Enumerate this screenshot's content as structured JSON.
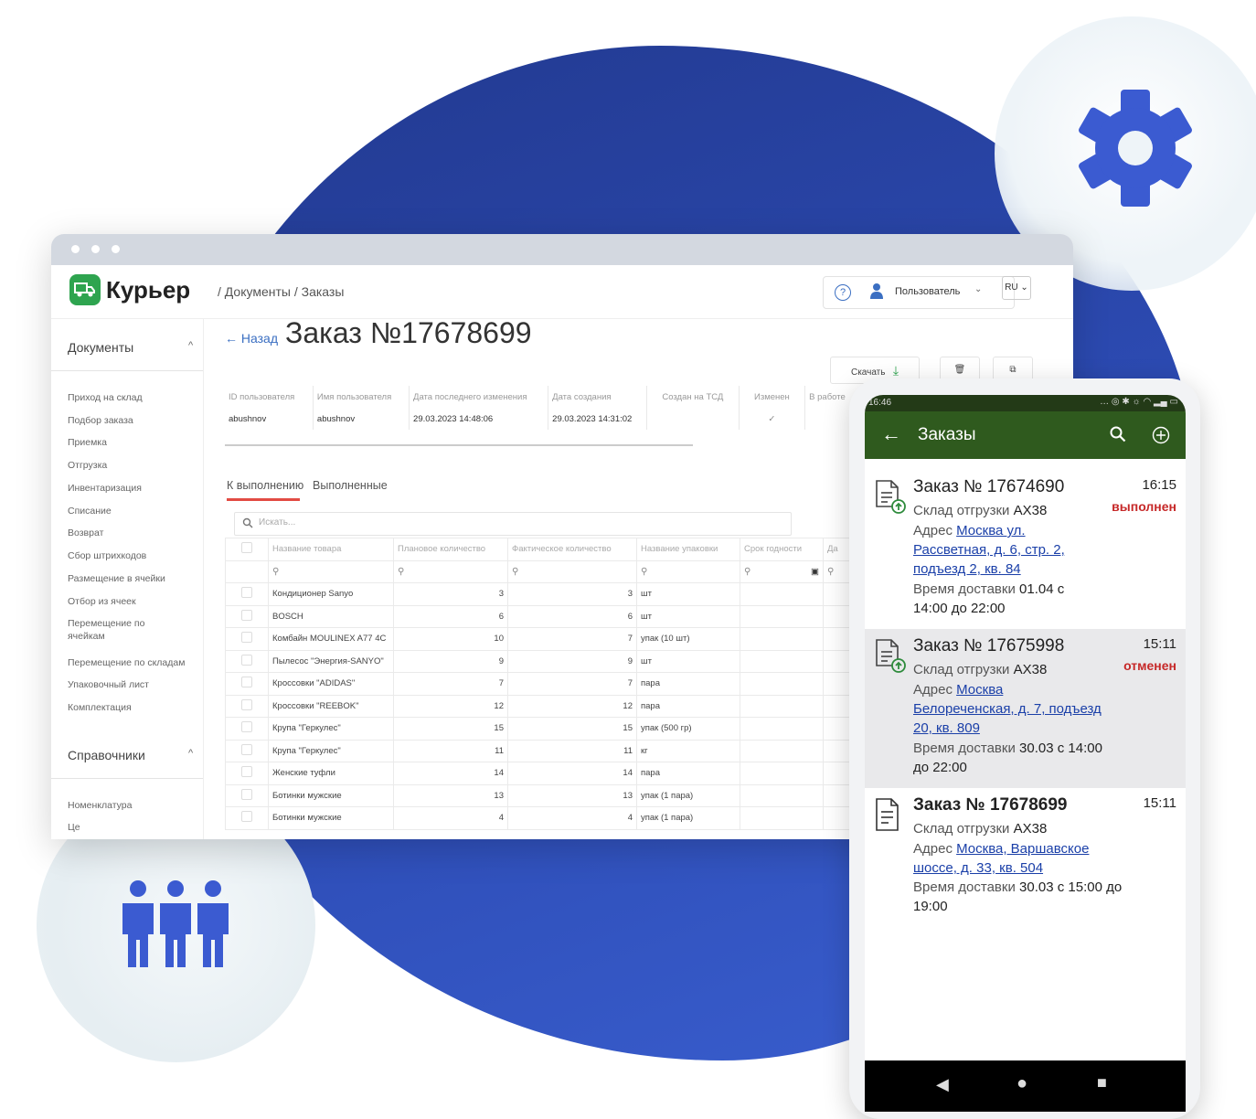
{
  "desktop": {
    "logo": "Курьер",
    "breadcrumb": "/ Документы / Заказы",
    "user": "Пользователь",
    "lang": "RU",
    "sidebar": {
      "section1": "Документы",
      "items1": [
        "Приход на склад",
        "Подбор заказа",
        "Приемка",
        "Отгрузка",
        "Инвентаризация",
        "Списание",
        "Возврат",
        "Сбор штрихкодов",
        "Размещение в ячейки",
        "Отбор из ячеек",
        "Перемещение по ячейкам",
        "Перемещение по складам",
        "Упаковочный лист",
        "Комплектация"
      ],
      "section2": "Справочники",
      "items2": [
        "Номенклатура",
        "Це"
      ]
    },
    "back": "← Назад",
    "title": "Заказ №17678699",
    "toolbar": {
      "download": "Скачать"
    },
    "meta": {
      "headers": [
        "ID пользователя",
        "Имя пользователя",
        "Дата последнего изменения",
        "Дата создания",
        "Создан на ТСД",
        "Изменен",
        "В работе"
      ],
      "values": [
        "abushnov",
        "abushnov",
        "29.03.2023 14:48:06",
        "29.03.2023 14:31:02",
        "",
        "✓",
        ""
      ]
    },
    "tabs": [
      "К выполнению",
      "Выполненные"
    ],
    "search_placeholder": "Искать...",
    "grid": {
      "headers": [
        "Название товара",
        "Плановое количество",
        "Фактическое количество",
        "Название упаковки",
        "Срок годности",
        "Да"
      ],
      "rows": [
        [
          "Кондиционер Sanyo",
          "3",
          "3",
          "шт"
        ],
        [
          "BOSCH",
          "6",
          "6",
          "шт"
        ],
        [
          "Комбайн MOULINEX A77 4C",
          "10",
          "7",
          "упак (10 шт)"
        ],
        [
          "Пылесос \"Энергия-SANYO\"",
          "9",
          "9",
          "шт"
        ],
        [
          "Кроссовки \"ADIDAS\"",
          "7",
          "7",
          "пара"
        ],
        [
          "Кроссовки \"REEBOK\"",
          "12",
          "12",
          "пара"
        ],
        [
          "Крупа \"Геркулес\"",
          "15",
          "15",
          "упак (500 гр)"
        ],
        [
          "Крупа \"Геркулес\"",
          "11",
          "11",
          "кг"
        ],
        [
          "Женские туфли",
          "14",
          "14",
          "пара"
        ],
        [
          "Ботинки мужские",
          "13",
          "13",
          "упак (1 пара)"
        ],
        [
          "Ботинки мужские",
          "4",
          "4",
          "упак (1 пара)"
        ]
      ]
    }
  },
  "mobile": {
    "status_time": "16:46",
    "title": "Заказы",
    "orders": [
      {
        "title": "Заказ № 17674690",
        "time": "16:15",
        "status": "выполнен",
        "warehouse_label": "Склад отгрузки",
        "warehouse": "АХ38",
        "address_label": "Адрес",
        "address_lines": [
          "Москва ул.",
          "Рассветная, д. 6, стр. 2,",
          "подъезд 2, кв. 84"
        ],
        "delivery_label": "Время доставки",
        "delivery_lines": [
          "01.04 с",
          "14:00 до 22:00"
        ]
      },
      {
        "title": "Заказ № 17675998",
        "time": "15:11",
        "status": "отменен",
        "warehouse_label": "Склад отгрузки",
        "warehouse": "АХ38",
        "address_label": "Адрес",
        "address_lines": [
          "Москва",
          "Белореченская, д. 7, подъезд",
          "20, кв. 809"
        ],
        "delivery_label": "Время доставки",
        "delivery_lines": [
          "30.03 с 14:00",
          "до 22:00"
        ]
      },
      {
        "title": "Заказ № 17678699",
        "time": "15:11",
        "status": "",
        "warehouse_label": "Склад отгрузки",
        "warehouse": "АХ38",
        "address_label": "Адрес",
        "address_lines": [
          "Москва, Варшавское",
          "шоссе, д. 33, кв. 504"
        ],
        "delivery_label": "Время доставки",
        "delivery_lines": [
          "30.03 с 15:00 до",
          "19:00"
        ]
      }
    ]
  },
  "colors": {
    "blob": "#2d4cb5",
    "gear": "#3b5bd1",
    "people": "#3b5bd1",
    "app_green": "#2f5a1e",
    "status_red": "#c62828",
    "link": "#1a3fa8"
  }
}
